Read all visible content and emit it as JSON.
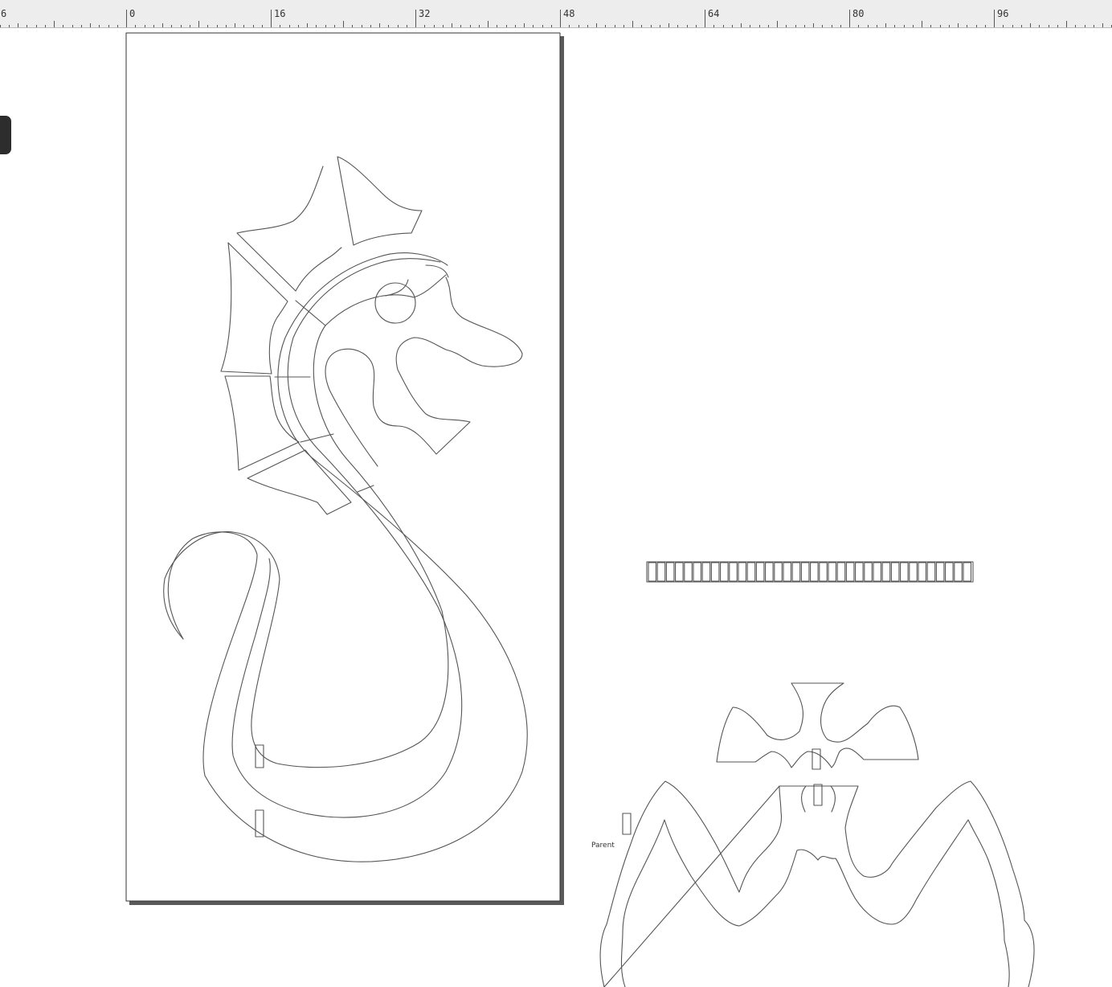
{
  "ruler": {
    "labels": [
      "6",
      "0",
      "16",
      "32",
      "48",
      "64",
      "80",
      "96"
    ]
  },
  "canvas": {
    "parent_label": "Parent"
  },
  "icons": {
    "side_handle": "panel-toggle-handle"
  },
  "colors": {
    "ruler_bg": "#ededed",
    "stroke": "#555555",
    "page_shadow": "#5a5a5a"
  }
}
